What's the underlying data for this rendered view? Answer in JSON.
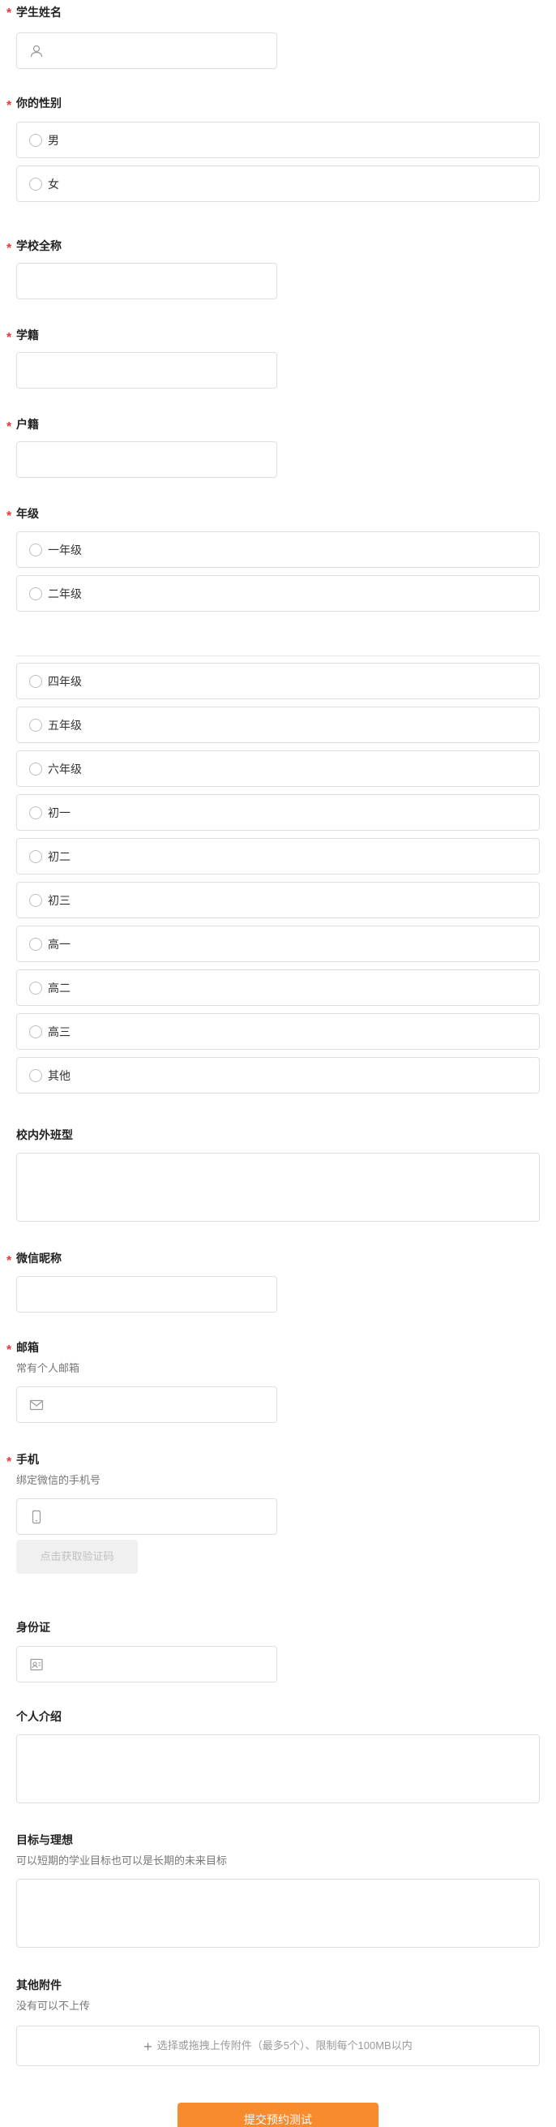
{
  "required_mark": "*",
  "fields": {
    "student_name": {
      "label": "学生姓名",
      "icon": "user-icon"
    },
    "gender": {
      "label": "你的性别",
      "options": [
        "男",
        "女"
      ]
    },
    "school": {
      "label": "学校全称"
    },
    "student_status": {
      "label": "学籍"
    },
    "household": {
      "label": "户籍"
    },
    "grade": {
      "label": "年级",
      "options": [
        "一年级",
        "二年级",
        "四年级",
        "五年级",
        "六年级",
        "初一",
        "初二",
        "初三",
        "高一",
        "高二",
        "高三",
        "其他"
      ]
    },
    "class_type": {
      "label": "校内外班型"
    },
    "wechat": {
      "label": "微信昵称"
    },
    "email": {
      "label": "邮箱",
      "hint": "常有个人邮箱",
      "icon": "mail-icon"
    },
    "phone": {
      "label": "手机",
      "hint": "绑定微信的手机号",
      "icon": "phone-icon",
      "code_button": "点击获取验证码"
    },
    "id_card": {
      "label": "身份证",
      "icon": "id-card-icon"
    },
    "intro": {
      "label": "个人介绍"
    },
    "goals": {
      "label": "目标与理想",
      "hint": "可以短期的学业目标也可以是长期的未来目标"
    },
    "attachments": {
      "label": "其他附件",
      "hint": "没有可以不上传",
      "upload_text": "选择或拖拽上传附件（最多5个）、限制每个100MB以内"
    }
  },
  "submit_label": "提交预约测试",
  "colors": {
    "accent": "#f98b2f",
    "required": "#e4393c",
    "border": "#dcdfe6"
  }
}
